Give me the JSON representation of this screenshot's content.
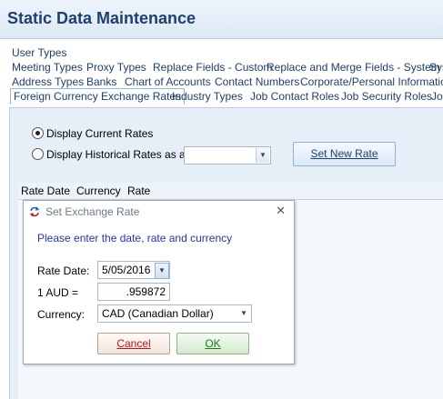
{
  "window": {
    "title": "Static Data Maintenance"
  },
  "tabs": {
    "row1": [
      "User Types"
    ],
    "row2": [
      "Meeting Types",
      "Proxy Types",
      "Replace Fields - Custom",
      "Replace and Merge Fields - System",
      "Sys"
    ],
    "row3": [
      "Address Types",
      "Banks",
      "Chart of Accounts",
      "Contact Numbers",
      "Corporate/Personal Information"
    ],
    "row4": [
      "Foreign Currency Exchange Rates",
      "Industry Types",
      "Job Contact Roles",
      "Job Security Roles",
      "Job"
    ],
    "active": "Foreign Currency Exchange Rates"
  },
  "rates": {
    "option_current": "Display Current Rates",
    "option_historical": "Display Historical Rates as at:",
    "selected_option": "current",
    "historical_date": "",
    "set_new_rate_button": "Set New Rate"
  },
  "grid": {
    "columns": [
      "Rate Date",
      "Currency",
      "Rate"
    ]
  },
  "dialog": {
    "title": "Set Exchange Rate",
    "prompt": "Please enter the date, rate and currency",
    "rate_date_label": "Rate Date:",
    "rate_date_value": "5/05/2016",
    "rate_label": "1 AUD =",
    "rate_value": ".959872",
    "currency_label": "Currency:",
    "currency_value": "CAD (Canadian Dollar)",
    "cancel_button": "Cancel",
    "ok_button": "OK"
  },
  "icons": {
    "dialog_icon": "exchange-arrows-icon",
    "close": "close-icon",
    "dropdown": "chevron-down-icon"
  },
  "colors": {
    "title_text": "#1f3f6e",
    "prompt_text": "#2434a8",
    "cancel_text": "#c0141c",
    "ok_text": "#1f7a1f",
    "panel_bg": "#e6eef8"
  }
}
